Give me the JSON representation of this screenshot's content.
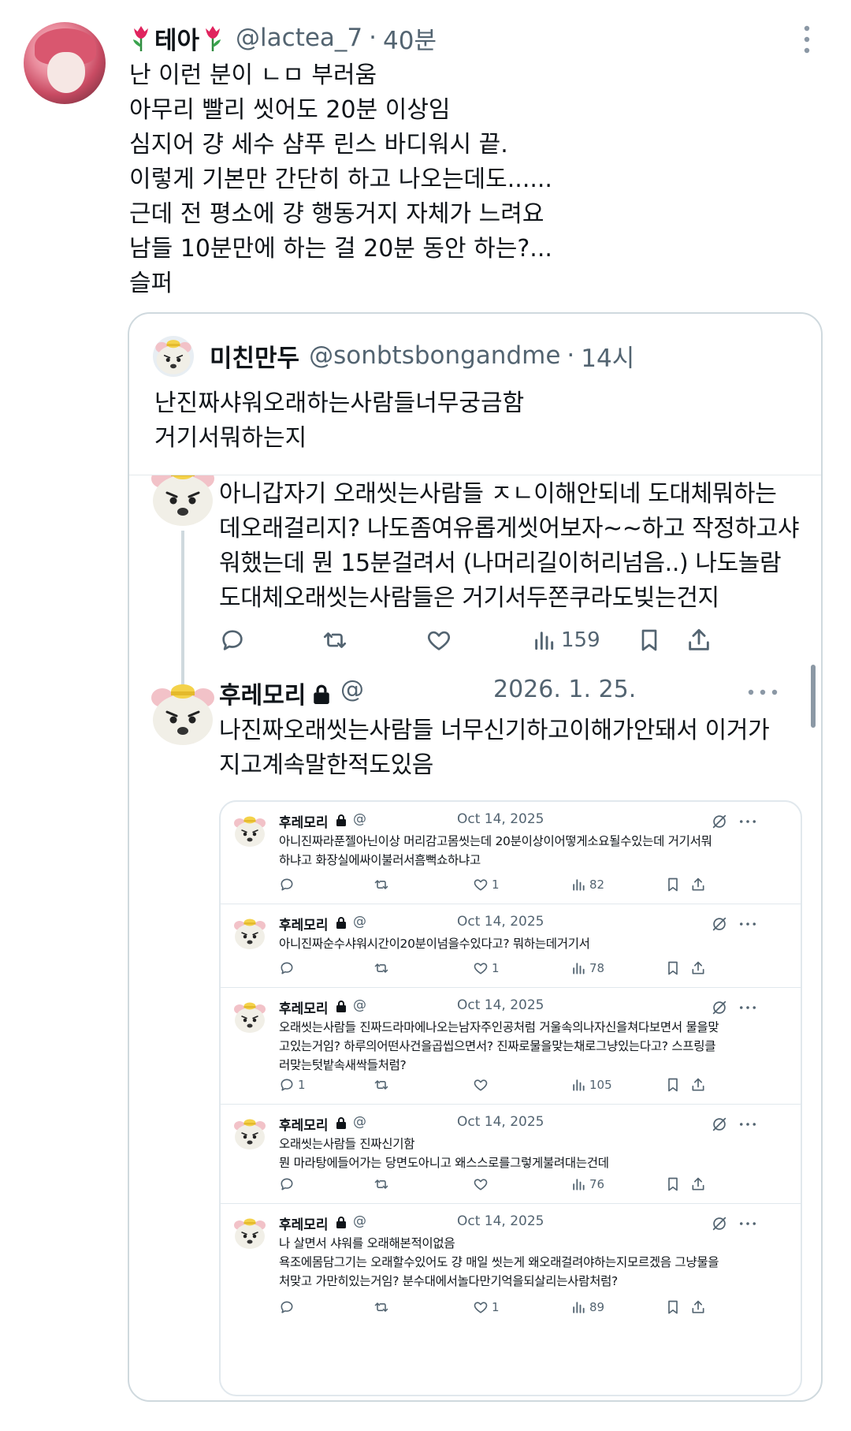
{
  "main_tweet": {
    "name": "테아",
    "handle": "@lactea_7",
    "separator": "·",
    "time": "40분",
    "lines": [
      "난 이런 분이 ㄴㅁ 부러움",
      "아무리 빨리 씻어도 20분 이상임",
      "심지어 걍 세수 샴푸 린스 바디워시 끝.",
      "이렇게 기본만 간단히 하고 나오는데도......",
      "근데 전 평소에 걍 행동거지 자체가 느려요",
      "남들 10분만에 하는 걸 20분 동안 하는?...",
      "슬퍼"
    ]
  },
  "quote": {
    "name": "미친만두",
    "handle": "@sonbtsbongandme",
    "separator": "·",
    "time": "14시",
    "lines": [
      "난진짜샤워오래하는사람들너무궁금함",
      "거기서뭐하는지"
    ]
  },
  "screenshot_tweet1": {
    "lines": [
      "아니갑자기 오래씻는사람들 ㅈㄴ이해안되네 도대체뭐하는",
      "데오래걸리지? 나도좀여유롭게씻어보자~~하고 작정하고샤",
      "워했는데 뭔 15분걸려서 (나머리길이허리넘음..) 나도놀람",
      "도대체오래씻는사람들은 거기서두쫀쿠라도빚는건지"
    ],
    "views": "159"
  },
  "screenshot_tweet2": {
    "name": "후레모리",
    "at": "@",
    "date": "2026. 1. 25.",
    "lines": [
      "나진짜오래씻는사람들 너무신기하고이해가안돼서 이거가",
      "지고계속말한적도있음"
    ]
  },
  "nested_tweets": [
    {
      "name": "후레모리",
      "at": "@",
      "date": "Oct 14, 2025",
      "lines": [
        "아니진짜라푼젤아닌이상 머리감고몸씻는데 20분이상이어떻게소요될수있는데 거기서뭐",
        "하냐고 화장실에싸이불러서흠뻑쇼하냐고"
      ],
      "replies": "",
      "likes": "1",
      "views": "82"
    },
    {
      "name": "후레모리",
      "at": "@",
      "date": "Oct 14, 2025",
      "lines": [
        "아니진짜순수샤워시간이20분이넘을수있다고? 뭐하는데거기서"
      ],
      "replies": "",
      "likes": "1",
      "views": "78"
    },
    {
      "name": "후레모리",
      "at": "@",
      "date": "Oct 14, 2025",
      "lines": [
        "오래씻는사람들 진짜드라마에나오는남자주인공처럼 거울속의나자신을쳐다보면서 물을맞",
        "고있는거임? 하루의어떤사건을곱씹으면서? 진짜로물을맞는채로그냥있는다고? 스프링클",
        "러맞는텃밭속새싹들처럼?"
      ],
      "replies": "1",
      "likes": "",
      "views": "105"
    },
    {
      "name": "후레모리",
      "at": "@",
      "date": "Oct 14, 2025",
      "lines": [
        "오래씻는사람들 진짜신기함",
        "뭔 마라탕에들어가는 당면도아니고 왜스스로를그렇게불려대는건데"
      ],
      "replies": "",
      "likes": "",
      "views": "76"
    },
    {
      "name": "후레모리",
      "at": "@",
      "date": "Oct 14, 2025",
      "lines": [
        "나 살면서 샤워를 오래해본적이없음",
        "욕조에몸담그기는 오래할수있어도 걍 매일 씻는게 왜오래걸려야하는지모르겠음 그냥물을",
        "처맞고 가만히있는거임? 분수대에서놀다만기억을되살리는사람처럼?"
      ],
      "replies": "",
      "likes": "1",
      "views": "89"
    }
  ],
  "colors": {
    "text": "#0f1419",
    "secondary": "#536471",
    "border": "#cfd9de",
    "tulip": "#e0245e"
  },
  "icons": [
    "tulip-icon",
    "more-icon",
    "reply-icon",
    "retweet-icon",
    "like-icon",
    "views-icon",
    "bookmark-icon",
    "share-icon",
    "lock-icon",
    "grok-icon"
  ]
}
